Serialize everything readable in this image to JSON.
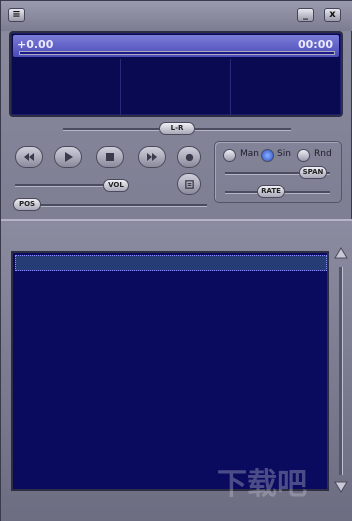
{
  "display": {
    "position": "+0.00",
    "time": "00:00"
  },
  "balance": {
    "label": "L-R"
  },
  "volume": {
    "label": "VOL"
  },
  "seek": {
    "label": "POS"
  },
  "mode": {
    "options": [
      "Man",
      "Sin",
      "Rnd"
    ],
    "selected": "Sin"
  },
  "span": {
    "label": "SPAN"
  },
  "rate": {
    "label": "RATE"
  },
  "watermark": "下载吧"
}
